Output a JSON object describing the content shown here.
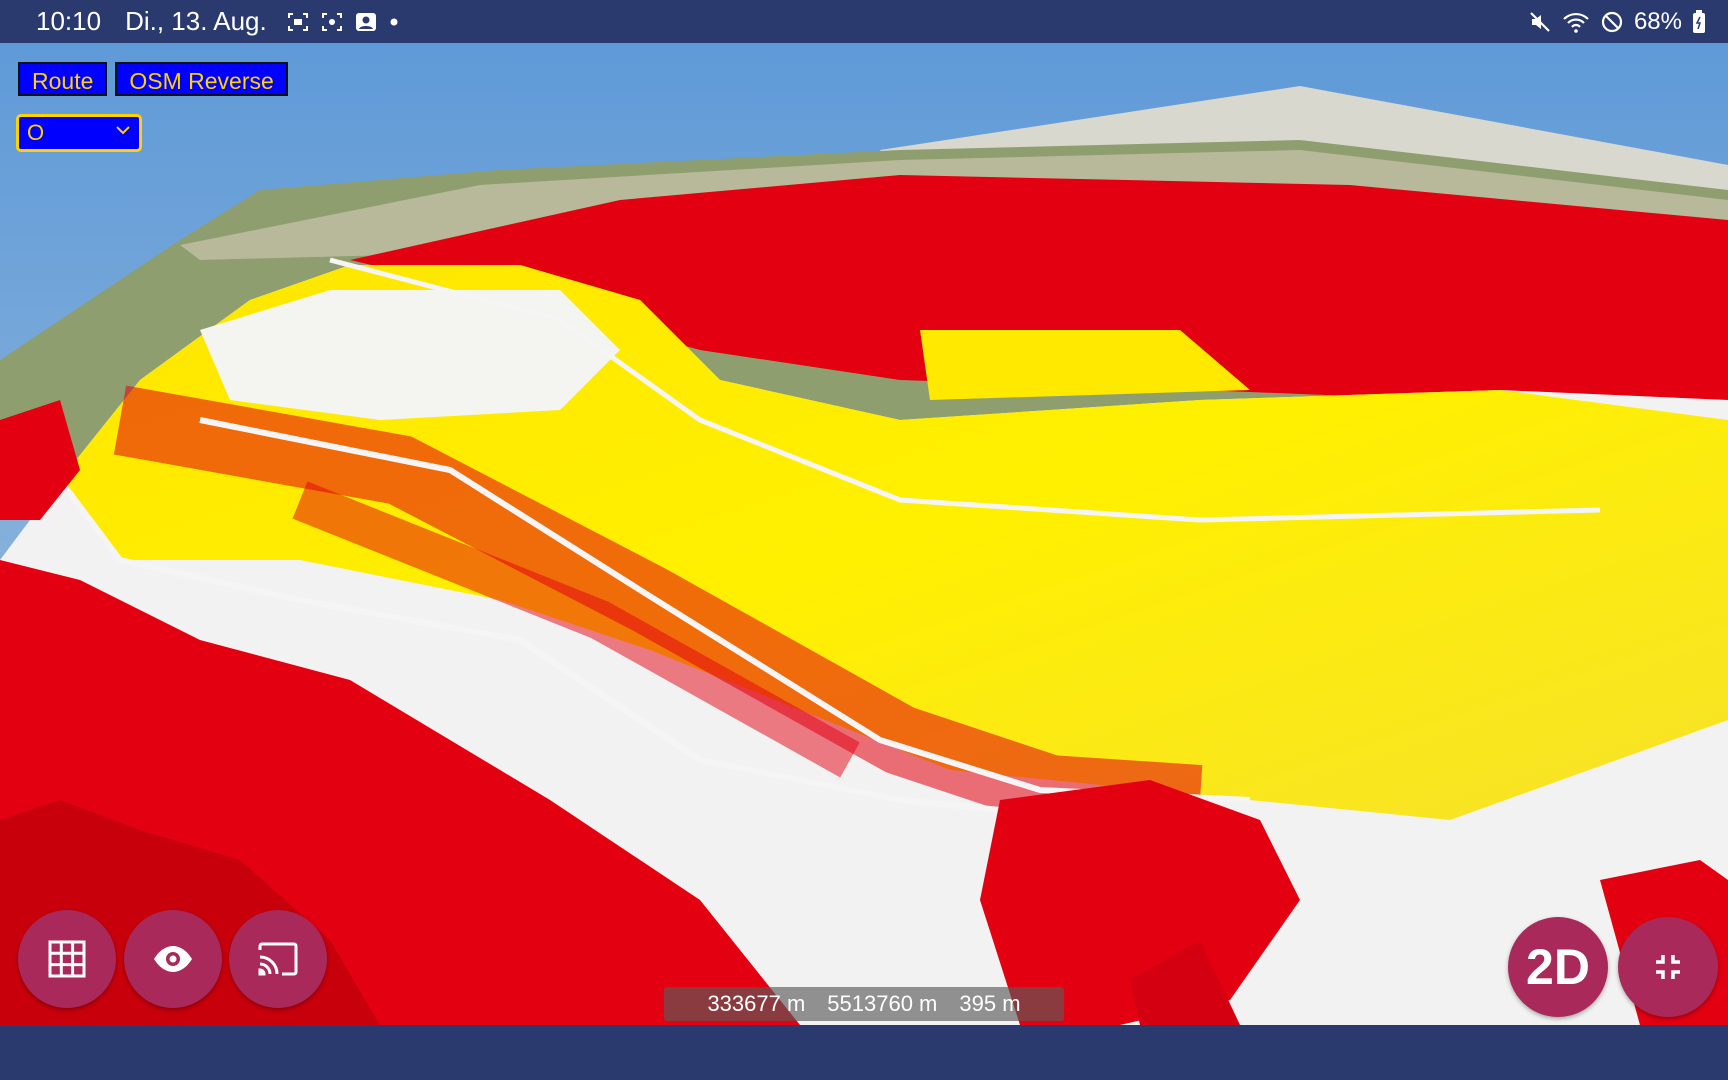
{
  "status_bar": {
    "time": "10:10",
    "date": "Di., 13. Aug.",
    "battery": "68%"
  },
  "toolbar": {
    "route_label": "Route",
    "osm_reverse_label": "OSM Reverse"
  },
  "layer_select": {
    "value": "O"
  },
  "fabs": {
    "grid_icon": "grid-icon",
    "eye_icon": "eye-icon",
    "cast_icon": "cast-icon",
    "mode_label": "2D",
    "collapse_icon": "collapse-icon"
  },
  "coordinates": {
    "x": "333677 m",
    "y": "5513760 m",
    "z": "395 m"
  },
  "colors": {
    "bar": "#2b3a6e",
    "button_bg": "#0000ff",
    "button_text": "#ffd200",
    "fab": "#a9295a",
    "terrain_red": "#e00010",
    "terrain_yellow": "#ffee00"
  }
}
